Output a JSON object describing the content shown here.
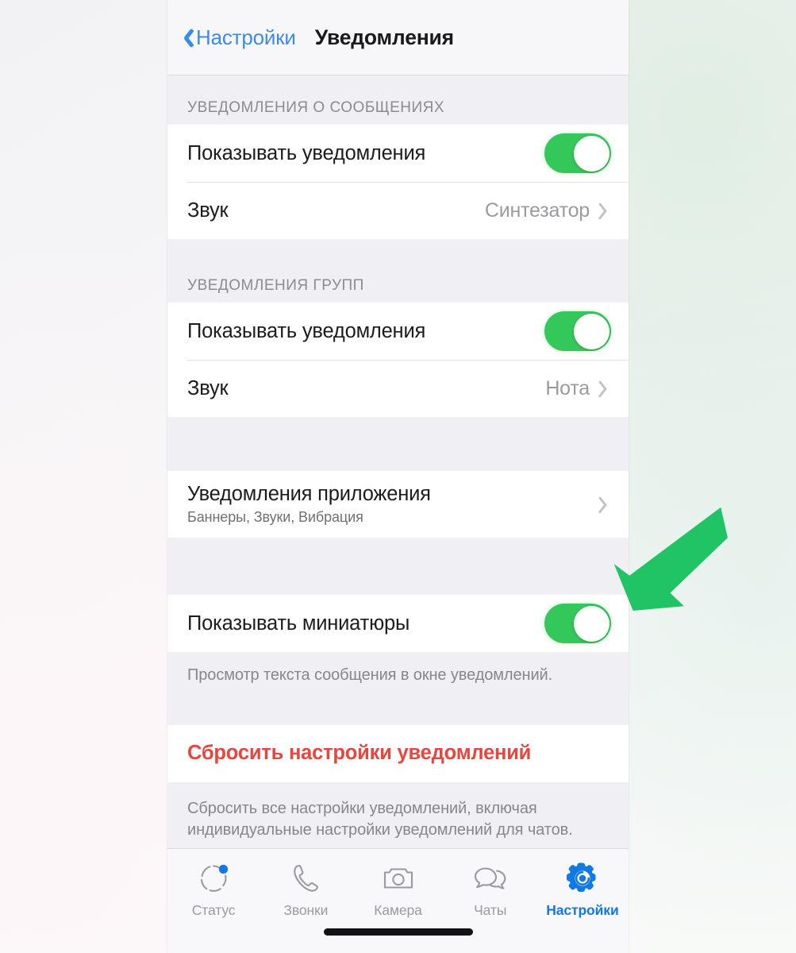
{
  "navbar": {
    "back_label": "Настройки",
    "title": "Уведомления",
    "back_icon": "chevron-left-icon",
    "accent_color": "#3b8aee"
  },
  "sections": [
    {
      "header": "УВЕДОМЛЕНИЯ О СООБЩЕНИЯХ",
      "rows": [
        {
          "label": "Показывать уведомления",
          "control": "toggle",
          "value": "on"
        },
        {
          "label": "Звук",
          "control": "disclosure",
          "value": "Синтезатор"
        }
      ]
    },
    {
      "header": "УВЕДОМЛЕНИЯ ГРУПП",
      "rows": [
        {
          "label": "Показывать уведомления",
          "control": "toggle",
          "value": "on"
        },
        {
          "label": "Звук",
          "control": "disclosure",
          "value": "Нота"
        }
      ]
    },
    {
      "header": "",
      "rows": [
        {
          "label": "Уведомления приложения",
          "subtitle": "Баннеры, Звуки, Вибрация",
          "control": "disclosure",
          "value": ""
        }
      ]
    },
    {
      "header": "",
      "rows": [
        {
          "label": "Показывать миниатюры",
          "control": "toggle",
          "value": "on"
        }
      ],
      "footer": "Просмотр текста сообщения в окне уведомлений."
    },
    {
      "header": "",
      "rows": [
        {
          "label": "Сбросить настройки уведомлений",
          "control": "destructive",
          "value": ""
        }
      ],
      "footer": "Сбросить все настройки уведомлений, включая индивидуальные настройки уведомлений для чатов."
    }
  ],
  "tabbar": {
    "items": [
      {
        "label": "Статус",
        "icon": "status-ring-icon",
        "active": false,
        "badge": true
      },
      {
        "label": "Звонки",
        "icon": "phone-handset-icon",
        "active": false,
        "badge": false
      },
      {
        "label": "Камера",
        "icon": "camera-icon",
        "active": false,
        "badge": false
      },
      {
        "label": "Чаты",
        "icon": "chat-bubbles-icon",
        "active": false,
        "badge": false
      },
      {
        "label": "Настройки",
        "icon": "gear-icon",
        "active": true,
        "badge": false
      }
    ],
    "active_color": "#1178e8",
    "inactive_color": "#9a9aa0"
  },
  "annotation": {
    "type": "arrow",
    "direction": "down-left",
    "color": "#20c464",
    "points_at": "Показывать миниатюры"
  },
  "colors": {
    "toggle_on": "#34c759",
    "destructive": "#e8453c",
    "group_background": "#efeff4",
    "card_background": "#ffffff"
  }
}
